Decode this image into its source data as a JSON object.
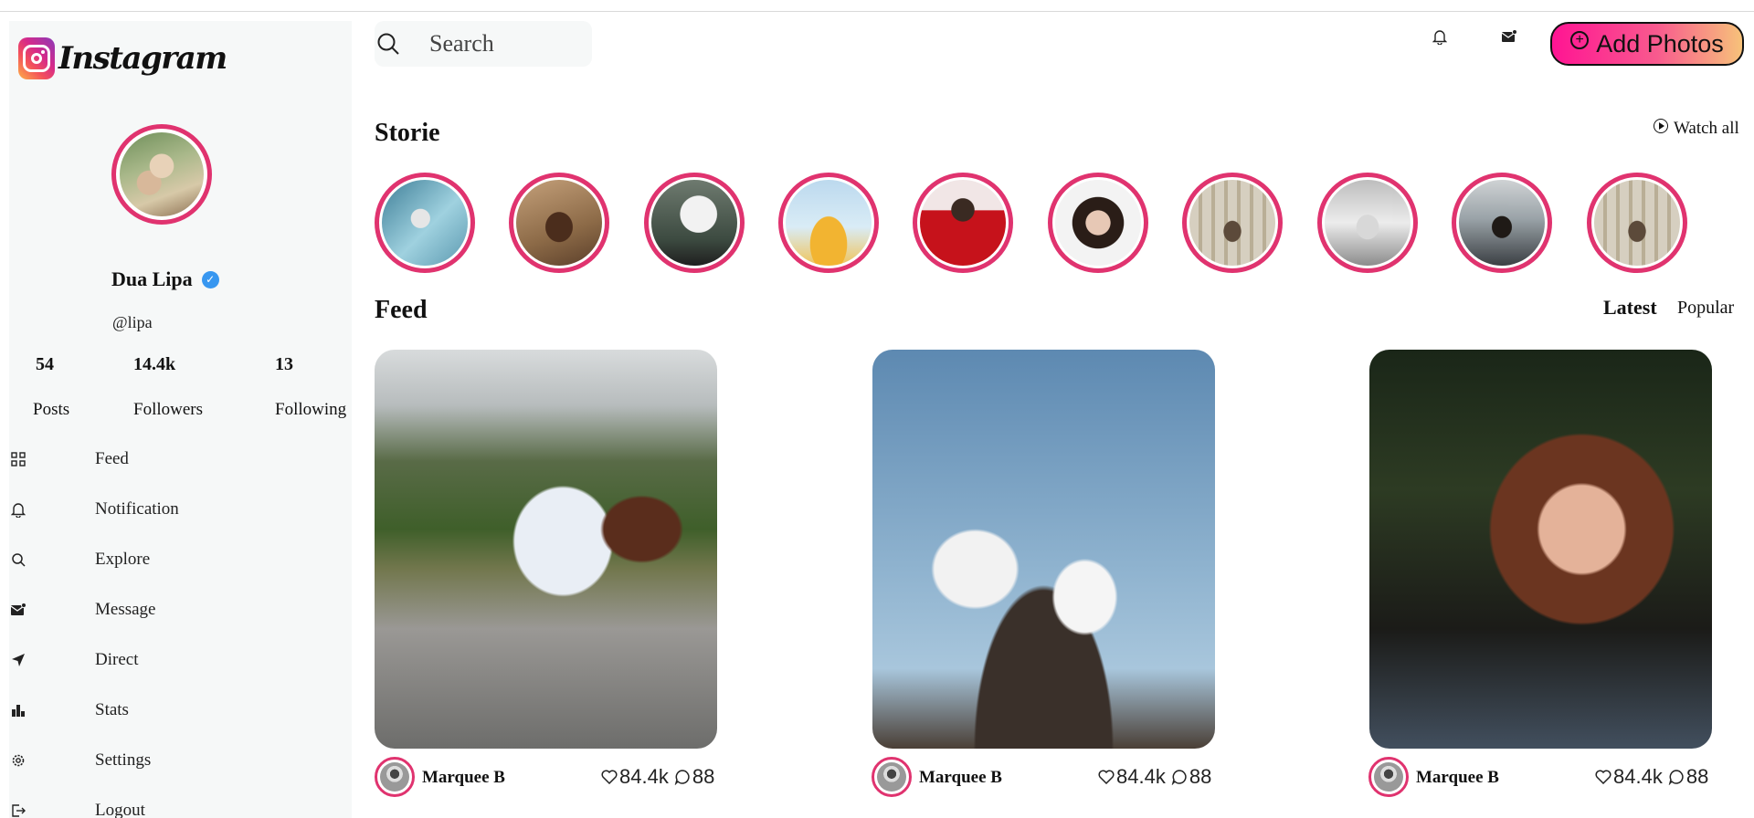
{
  "app": {
    "brand": "Instagram",
    "colors": {
      "story_ring": "#e0336f",
      "verified": "#3897f0",
      "sidebar_bg": "#f6f8f8",
      "button_gradient_start": "#ff1493",
      "button_gradient_end": "#f7c27a"
    }
  },
  "profile": {
    "name": "Dua Lipa",
    "handle": "@lipa",
    "verified_icon": "verified-badge-icon",
    "stats": [
      {
        "value": "54",
        "label": "Posts"
      },
      {
        "value": "14.4k",
        "label": "Followers"
      },
      {
        "value": "13",
        "label": "Following"
      }
    ]
  },
  "nav": [
    {
      "label": "Feed",
      "icon": "grid-icon"
    },
    {
      "label": "Notification",
      "icon": "bell-icon"
    },
    {
      "label": "Explore",
      "icon": "search-icon"
    },
    {
      "label": "Message",
      "icon": "message-icon"
    },
    {
      "label": "Direct",
      "icon": "send-icon"
    },
    {
      "label": "Stats",
      "icon": "bar-chart-icon"
    },
    {
      "label": "Settings",
      "icon": "gear-icon"
    },
    {
      "label": "Logout",
      "icon": "logout-icon"
    }
  ],
  "header": {
    "search_placeholder": "Search",
    "add_photos_label": "Add Photos"
  },
  "stories": {
    "title": "Storie",
    "watch_all_label": "Watch all",
    "count": 10
  },
  "feed": {
    "title": "Feed",
    "tabs": [
      {
        "label": "Latest",
        "active": true
      },
      {
        "label": "Popular",
        "active": false
      }
    ],
    "posts": [
      {
        "author": "Marquee B",
        "likes": "84.4k",
        "comments": "88"
      },
      {
        "author": "Marquee B",
        "likes": "84.4k",
        "comments": "88"
      },
      {
        "author": "Marquee B",
        "likes": "84.4k",
        "comments": "88"
      }
    ]
  }
}
